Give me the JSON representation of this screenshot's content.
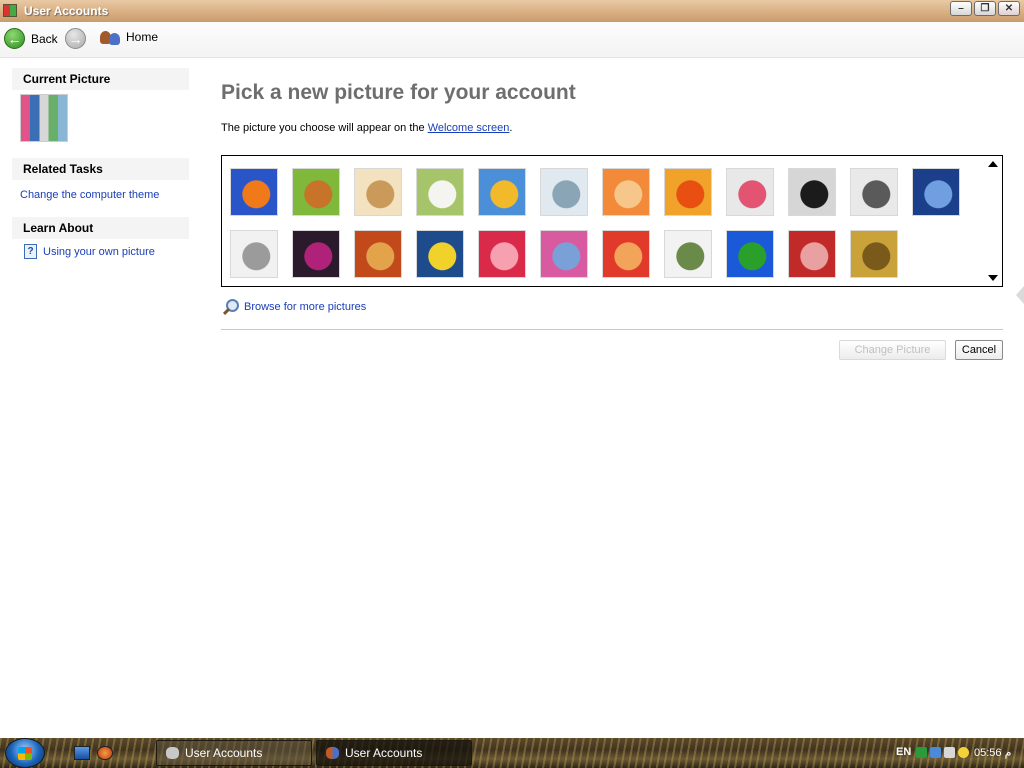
{
  "window": {
    "title": "User Accounts",
    "controls": [
      "minimize",
      "restore",
      "close"
    ]
  },
  "nav": {
    "back_label": "Back",
    "home_label": "Home"
  },
  "sidebar": {
    "current_picture_header": "Current Picture",
    "related_tasks_header": "Related Tasks",
    "related_tasks": [
      "Change the computer theme"
    ],
    "learn_about_header": "Learn About",
    "learn_about": [
      "Using your own picture"
    ]
  },
  "main": {
    "title": "Pick a new picture for your account",
    "subtitle_prefix": "The picture you choose will appear on the ",
    "subtitle_link": "Welcome screen",
    "subtitle_suffix": ".",
    "pictures": [
      {
        "name": "fish",
        "colors": [
          "#2a55c9",
          "#f07a1a"
        ]
      },
      {
        "name": "dog",
        "colors": [
          "#7fb83a",
          "#c8732a"
        ]
      },
      {
        "name": "guitar",
        "colors": [
          "#f3e2c0",
          "#c99a5a"
        ]
      },
      {
        "name": "lucky-cat",
        "colors": [
          "#a6c56a",
          "#f4f4f0"
        ]
      },
      {
        "name": "sunflower",
        "colors": [
          "#4a8fd8",
          "#f2b92a"
        ]
      },
      {
        "name": "spinning-top",
        "colors": [
          "#dfe9ef",
          "#8aa5b5"
        ]
      },
      {
        "name": "starfish",
        "colors": [
          "#f28a3a",
          "#f6c68a"
        ]
      },
      {
        "name": "orange-flower",
        "colors": [
          "#f0a22a",
          "#e84f10"
        ]
      },
      {
        "name": "pink-flower",
        "colors": [
          "#e8e8e8",
          "#e25472"
        ]
      },
      {
        "name": "record-player",
        "colors": [
          "#d6d6d6",
          "#1b1b1b"
        ]
      },
      {
        "name": "jacks",
        "colors": [
          "#e9e9e9",
          "#5a5a5a"
        ]
      },
      {
        "name": "lighthouse",
        "colors": [
          "#1c3f8c",
          "#6f9fe0"
        ]
      },
      {
        "name": "robot",
        "colors": [
          "#f1f1f1",
          "#9b9b9b"
        ]
      },
      {
        "name": "ball",
        "colors": [
          "#2b1a2c",
          "#b0227a"
        ]
      },
      {
        "name": "fabric",
        "colors": [
          "#c24a1a",
          "#e2a34a"
        ]
      },
      {
        "name": "leaf",
        "colors": [
          "#1e4b8c",
          "#f0d22a"
        ]
      },
      {
        "name": "pink-starburst",
        "colors": [
          "#d92a4a",
          "#f6a0b0"
        ]
      },
      {
        "name": "scarves",
        "colors": [
          "#d85aa0",
          "#7aa0d8"
        ]
      },
      {
        "name": "stripes",
        "colors": [
          "#e23a2a",
          "#f2a45a"
        ]
      },
      {
        "name": "marbles",
        "colors": [
          "#f2f2f2",
          "#6a8a4a"
        ]
      },
      {
        "name": "window",
        "colors": [
          "#1a5ad8",
          "#2aa02a"
        ]
      },
      {
        "name": "pattern",
        "colors": [
          "#c22a2a",
          "#e8a0a0"
        ]
      },
      {
        "name": "gold-wheel",
        "colors": [
          "#c9a23a",
          "#7a5a1a"
        ]
      }
    ],
    "browse_link": "Browse for more pictures",
    "change_picture_button": "Change Picture",
    "cancel_button": "Cancel"
  },
  "taskbar": {
    "tasks": [
      "User Accounts",
      "User Accounts"
    ],
    "language": "EN",
    "clock": "05:56 م"
  }
}
